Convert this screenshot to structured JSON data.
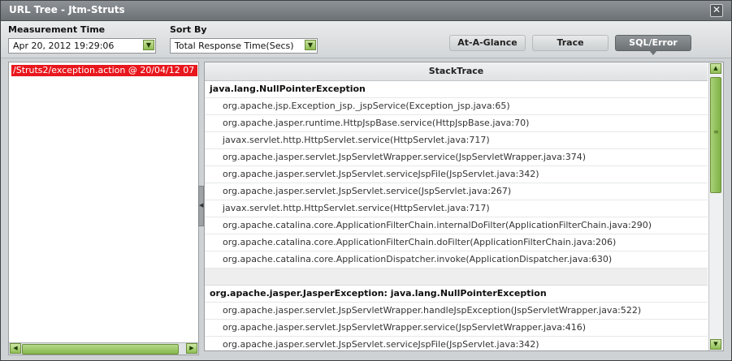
{
  "window": {
    "title": "URL Tree - Jtm-Struts",
    "close_glyph": "✕"
  },
  "controls": {
    "measurement_time": {
      "label": "Measurement Time",
      "value": "Apr 20, 2012 19:29:06"
    },
    "sort_by": {
      "label": "Sort By",
      "value": "Total Response Time(Secs)"
    },
    "tabs": [
      {
        "label": "At-A-Glance",
        "active": false
      },
      {
        "label": "Trace",
        "active": false
      },
      {
        "label": "SQL/Error",
        "active": true
      }
    ]
  },
  "url_tree": {
    "selected_item": "/Struts2/exception.action @ 20/04/12 07"
  },
  "stacktrace": {
    "header": "StackTrace",
    "rows": [
      {
        "kind": "exc",
        "text": "java.lang.NullPointerException"
      },
      {
        "kind": "frame",
        "text": "org.apache.jsp.Exception_jsp._jspService(Exception_jsp.java:65)"
      },
      {
        "kind": "frame",
        "text": "org.apache.jasper.runtime.HttpJspBase.service(HttpJspBase.java:70)"
      },
      {
        "kind": "frame",
        "text": "javax.servlet.http.HttpServlet.service(HttpServlet.java:717)"
      },
      {
        "kind": "frame",
        "text": "org.apache.jasper.servlet.JspServletWrapper.service(JspServletWrapper.java:374)"
      },
      {
        "kind": "frame",
        "text": "org.apache.jasper.servlet.JspServlet.serviceJspFile(JspServlet.java:342)"
      },
      {
        "kind": "frame",
        "text": "org.apache.jasper.servlet.JspServlet.service(JspServlet.java:267)"
      },
      {
        "kind": "frame",
        "text": "javax.servlet.http.HttpServlet.service(HttpServlet.java:717)"
      },
      {
        "kind": "frame",
        "text": "org.apache.catalina.core.ApplicationFilterChain.internalDoFilter(ApplicationFilterChain.java:290)"
      },
      {
        "kind": "frame",
        "text": "org.apache.catalina.core.ApplicationFilterChain.doFilter(ApplicationFilterChain.java:206)"
      },
      {
        "kind": "frame",
        "text": "org.apache.catalina.core.ApplicationDispatcher.invoke(ApplicationDispatcher.java:630)"
      },
      {
        "kind": "blank",
        "text": ""
      },
      {
        "kind": "exc",
        "text": "org.apache.jasper.JasperException: java.lang.NullPointerException"
      },
      {
        "kind": "frame",
        "text": "org.apache.jasper.servlet.JspServletWrapper.handleJspException(JspServletWrapper.java:522)"
      },
      {
        "kind": "frame",
        "text": "org.apache.jasper.servlet.JspServletWrapper.service(JspServletWrapper.java:416)"
      },
      {
        "kind": "frame",
        "text": "org.apache.jasper.servlet.JspServlet.serviceJspFile(JspServlet.java:342)"
      }
    ]
  },
  "icons": {
    "dropdown": "chevron-down-icon",
    "scroll_up": "triangle-up-icon",
    "scroll_down": "triangle-down-icon",
    "scroll_left": "triangle-left-icon",
    "scroll_right": "triangle-right-icon",
    "splitter": "collapse-handle-icon"
  },
  "colors": {
    "selected_row": "#e8171d",
    "accent_green": "#8ebd52",
    "active_tab": "#6d7275"
  }
}
